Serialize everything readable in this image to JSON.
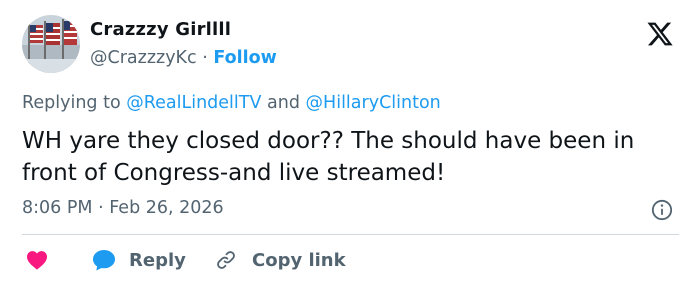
{
  "tweet": {
    "author": {
      "display_name": "Crazzzy Girllll",
      "handle": "@CrazzzyKc",
      "separator": "·",
      "follow_label": "Follow",
      "avatar": "flags-avatar"
    },
    "replying_to": {
      "prefix": "Replying to",
      "mention1": "@RealLindellTV",
      "conjunction": "and",
      "mention2": "@HillaryClinton"
    },
    "text": "WH yare they closed door?? The should have been in front of Congress-and live streamed!",
    "timestamp": "8:06 PM · Feb 26, 2026",
    "actions": {
      "like_icon": "heart-icon",
      "reply_label": "Reply",
      "copy_label": "Copy link"
    }
  },
  "colors": {
    "accent": "#1d9bf0",
    "heart": "#f91880",
    "secondary_text": "#536471",
    "primary_text": "#0f1419"
  }
}
